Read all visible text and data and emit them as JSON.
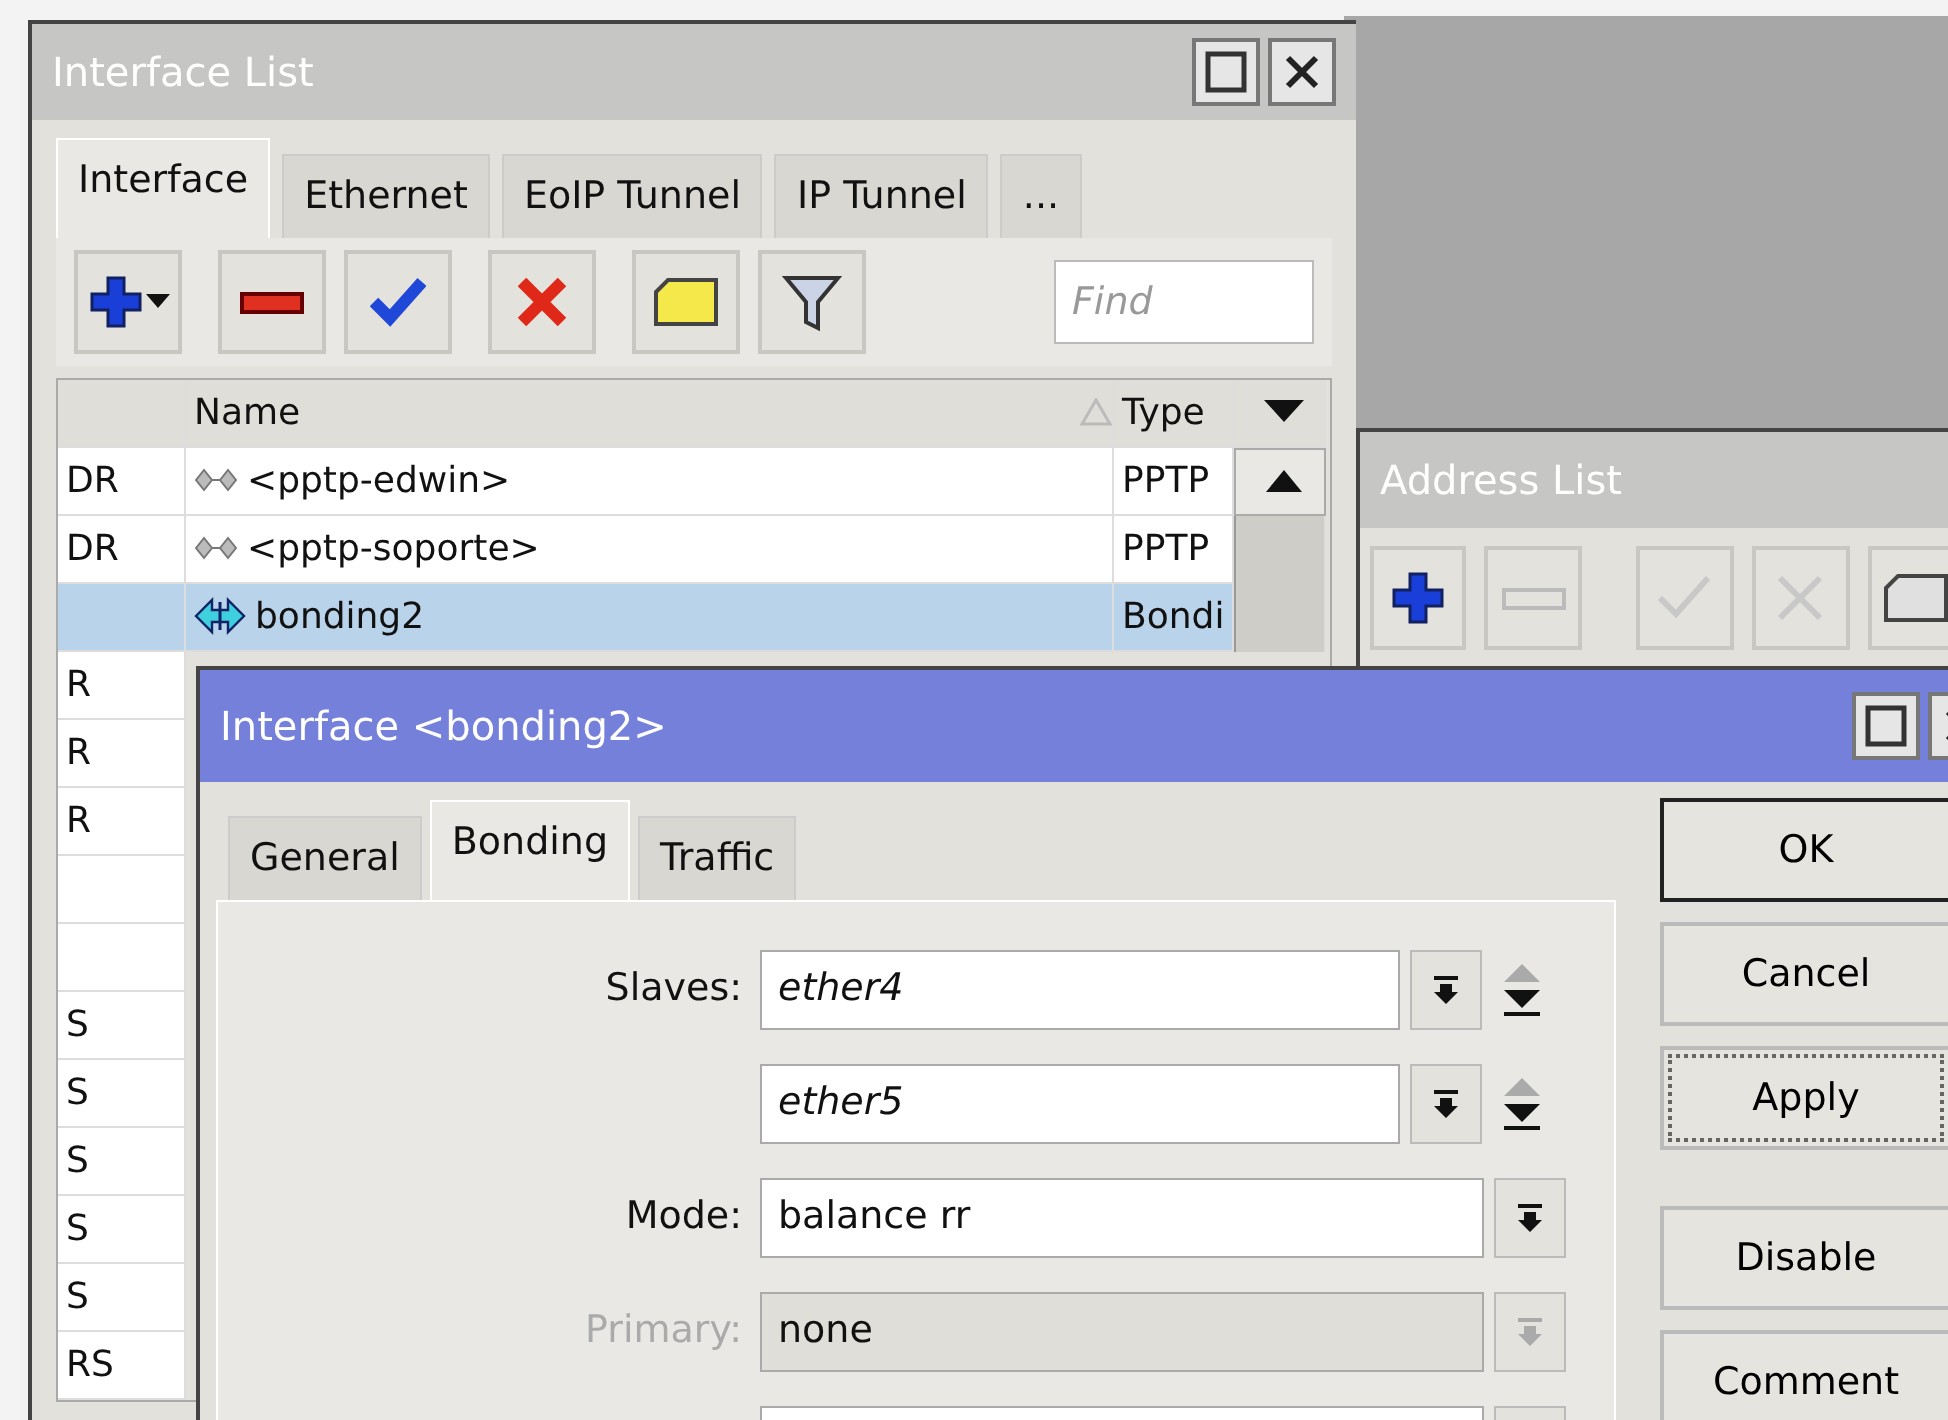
{
  "interface_list": {
    "title": "Interface List",
    "tabs": [
      {
        "label": "Interface",
        "selected": true
      },
      {
        "label": "Ethernet",
        "selected": false
      },
      {
        "label": "EoIP Tunnel",
        "selected": false
      },
      {
        "label": "IP Tunnel",
        "selected": false
      },
      {
        "label": "...",
        "selected": false
      }
    ],
    "toolbar": [
      {
        "kind": "add"
      },
      {
        "kind": "remove"
      },
      {
        "kind": "enable"
      },
      {
        "kind": "disable"
      },
      {
        "kind": "comment"
      },
      {
        "kind": "filter"
      }
    ],
    "find": {
      "placeholder": "Find"
    },
    "columns": [
      "Name",
      "Type"
    ],
    "rows": [
      {
        "flags": "DR",
        "kind": "tunnel",
        "name": "<pptp-edwin>",
        "type": "PPTP",
        "selected": false
      },
      {
        "flags": "DR",
        "kind": "tunnel",
        "name": "<pptp-soporte>",
        "type": "PPTP",
        "selected": false
      },
      {
        "kind": "bond",
        "name": "bonding2",
        "type": "Bondi",
        "selected": true
      },
      {
        "flags": "R",
        "kind": "covered",
        "selected": false
      },
      {
        "flags": "R",
        "kind": "covered",
        "selected": false
      },
      {
        "flags": "R",
        "kind": "covered",
        "selected": false
      },
      {
        "kind": "covered",
        "selected": false
      },
      {
        "kind": "covered",
        "selected": false
      },
      {
        "flags": "S",
        "kind": "covered",
        "selected": false
      },
      {
        "flags": "S",
        "kind": "covered",
        "selected": false
      },
      {
        "flags": "S",
        "kind": "covered",
        "selected": false
      },
      {
        "flags": "S",
        "kind": "covered",
        "selected": false
      },
      {
        "flags": "S",
        "kind": "covered",
        "selected": false
      },
      {
        "flags": "RS",
        "kind": "covered",
        "selected": false
      }
    ]
  },
  "address_list": {
    "title": "Address List",
    "toolbar": [
      {
        "kind": "add",
        "disabled": false
      },
      {
        "kind": "remove",
        "disabled": true
      },
      {
        "kind": "enable",
        "disabled": true
      },
      {
        "kind": "disable",
        "disabled": true
      },
      {
        "kind": "comment",
        "disabled": true
      }
    ]
  },
  "dialog": {
    "title": "Interface <bonding2>",
    "tabs": [
      {
        "label": "General",
        "selected": false
      },
      {
        "label": "Bonding",
        "selected": true
      },
      {
        "label": "Traffic",
        "selected": false
      }
    ],
    "fields": [
      {
        "kind": "multi",
        "label": "Slaves:",
        "value": "ether4",
        "disabled": false
      },
      {
        "kind": "multi",
        "value": "ether5",
        "disabled": false
      },
      {
        "kind": "select",
        "label": "Mode:",
        "value": "balance rr",
        "disabled": false
      },
      {
        "kind": "select",
        "label": "Primary:",
        "value": "none",
        "disabled": true
      },
      {
        "kind": "select",
        "disabled": false
      }
    ],
    "buttons": [
      {
        "label": "OK",
        "default": true,
        "focused": false
      },
      {
        "label": "Cancel",
        "default": false,
        "focused": false
      },
      {
        "label": "Apply",
        "default": false,
        "focused": true
      },
      {
        "label": "Disable",
        "default": false,
        "focused": false
      },
      {
        "label": "Comment",
        "default": false,
        "focused": false
      }
    ]
  }
}
